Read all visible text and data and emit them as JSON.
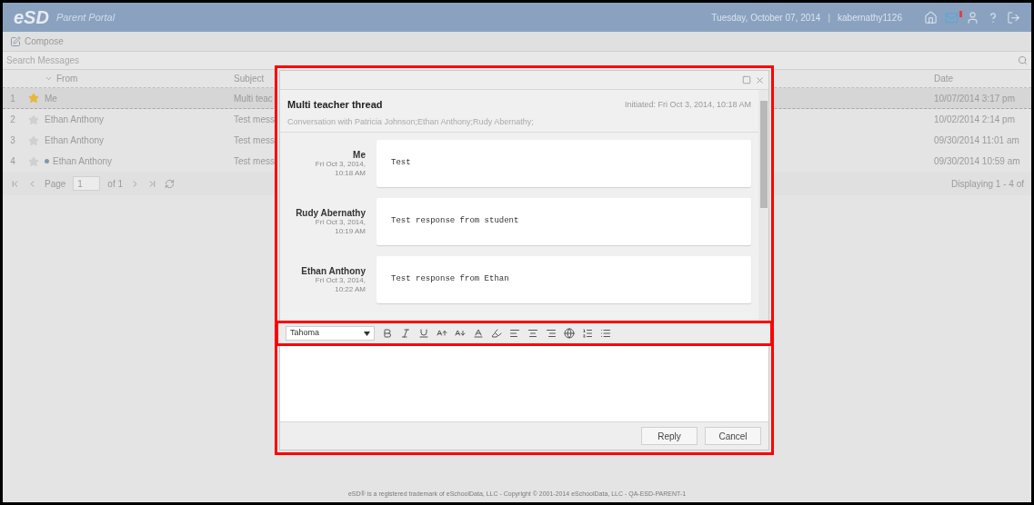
{
  "header": {
    "logo": "eSD",
    "portal": "Parent Portal",
    "date": "Tuesday, October 07, 2014",
    "separator": "|",
    "user": "kabernathy1126",
    "mail_alert": true
  },
  "toolbar": {
    "compose": "Compose"
  },
  "search": {
    "placeholder": "Search Messages"
  },
  "grid": {
    "columns": [
      "From",
      "Subject",
      "Date"
    ],
    "rows": [
      {
        "number": "1",
        "from": "Me",
        "subject": "Multi teac",
        "date": "10/07/2014 3:17 pm",
        "starred": true,
        "selected": true,
        "unread": false
      },
      {
        "number": "2",
        "from": "Ethan Anthony",
        "subject": "Test mess",
        "date": "10/02/2014 2:14 pm",
        "starred": false,
        "selected": false,
        "unread": false
      },
      {
        "number": "3",
        "from": "Ethan Anthony",
        "subject": "Test mess",
        "date": "09/30/2014 11:01 am",
        "starred": false,
        "selected": false,
        "unread": false
      },
      {
        "number": "4",
        "from": "Ethan Anthony",
        "subject": "Test mess",
        "date": "09/30/2014 10:59 am",
        "starred": false,
        "selected": false,
        "unread": true
      }
    ]
  },
  "pager": {
    "page_label": "Page",
    "page": "1",
    "of": "of 1",
    "displaying": "Displaying 1 - 4 of"
  },
  "footer": "eSD® is a registered trademark of eSchoolData, LLC - Copyright © 2001-2014 eSchoolData, LLC - QA-ESD-PARENT-1",
  "dialog": {
    "title": "Multi teacher thread",
    "initiated": "Initiated: Fri Oct 3, 2014, 10:18 AM",
    "conversation": "Conversation with Patricia Johnson;Ethan Anthony;Rudy Abernathy;",
    "messages": [
      {
        "author": "Me",
        "time": "Fri Oct 3, 2014, 10:18 AM",
        "body": "Test"
      },
      {
        "author": "Rudy Abernathy",
        "time": "Fri Oct 3, 2014, 10:19 AM",
        "body": "Test response from student"
      },
      {
        "author": "Ethan Anthony",
        "time": "Fri Oct 3, 2014, 10:22 AM",
        "body": "Test response from Ethan"
      }
    ],
    "font": "Tahoma",
    "buttons": [
      "Reply",
      "Cancel"
    ]
  }
}
